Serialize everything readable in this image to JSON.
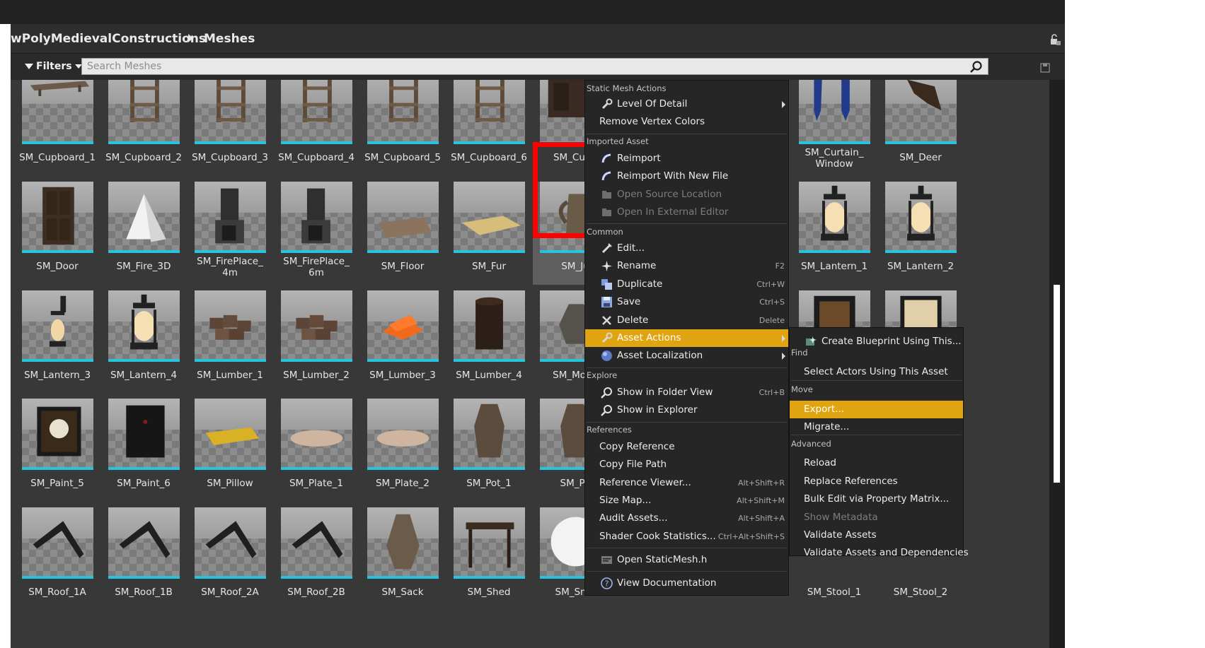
{
  "breadcrumb": {
    "root": "wPolyMedievalConstructions",
    "current": "Meshes"
  },
  "filters_label": "Filters",
  "search": {
    "placeholder": "Search Meshes",
    "value": ""
  },
  "assets": [
    {
      "name": "SM_Cupboard_1",
      "icon": "bench-mesh"
    },
    {
      "name": "SM_Cupboard_2",
      "icon": "shelf-mesh"
    },
    {
      "name": "SM_Cupboard_3",
      "icon": "shelf-mesh"
    },
    {
      "name": "SM_Cupboard_4",
      "icon": "shelf-mesh"
    },
    {
      "name": "SM_Cupboard_5",
      "icon": "shelf-mesh"
    },
    {
      "name": "SM_Cupboard_6",
      "icon": "shelf-mesh"
    },
    {
      "name": "SM_Cupb",
      "icon": "cupboard-mesh"
    },
    {
      "name": "",
      "icon": "hidden"
    },
    {
      "name": "",
      "icon": "hidden"
    },
    {
      "name": "SM_Curtain_Window",
      "icon": "curtain-mesh"
    },
    {
      "name": "SM_Deer",
      "icon": "deer-mesh"
    },
    {
      "name": "SM_Door",
      "icon": "door-mesh"
    },
    {
      "name": "SM_Fire_3D",
      "icon": "fire-cone-mesh"
    },
    {
      "name": "SM_FirePlace_4m",
      "icon": "fireplace-mesh"
    },
    {
      "name": "SM_FirePlace_6m",
      "icon": "fireplace-mesh"
    },
    {
      "name": "SM_Floor",
      "icon": "floor-mesh"
    },
    {
      "name": "SM_Fur",
      "icon": "fur-mesh"
    },
    {
      "name": "SM_Ju",
      "icon": "jug-mesh"
    },
    {
      "name": "",
      "icon": "hidden"
    },
    {
      "name": "",
      "icon": "hidden"
    },
    {
      "name": "SM_Lantern_1",
      "icon": "lantern-mesh"
    },
    {
      "name": "SM_Lantern_2",
      "icon": "lantern-mesh"
    },
    {
      "name": "SM_Lantern_3",
      "icon": "wall-lantern-mesh"
    },
    {
      "name": "SM_Lantern_4",
      "icon": "lantern-mesh"
    },
    {
      "name": "SM_Lumber_1",
      "icon": "lumber-mesh"
    },
    {
      "name": "SM_Lumber_2",
      "icon": "lumber-mesh"
    },
    {
      "name": "SM_Lumber_3",
      "icon": "lumber-orange-mesh"
    },
    {
      "name": "SM_Lumber_4",
      "icon": "stump-mesh"
    },
    {
      "name": "SM_Mone",
      "icon": "money-bag-mesh"
    },
    {
      "name": "",
      "icon": "hidden"
    },
    {
      "name": "",
      "icon": "hidden"
    },
    {
      "name": "",
      "icon": "book-frame-mesh"
    },
    {
      "name": "",
      "icon": "map-frame-mesh"
    },
    {
      "name": "SM_Paint_5",
      "icon": "eagle-painting-mesh"
    },
    {
      "name": "SM_Paint_6",
      "icon": "dark-painting-mesh"
    },
    {
      "name": "SM_Pillow",
      "icon": "pillow-mesh"
    },
    {
      "name": "SM_Plate_1",
      "icon": "plate-mesh"
    },
    {
      "name": "SM_Plate_2",
      "icon": "plate-mesh"
    },
    {
      "name": "SM_Pot_1",
      "icon": "pot-mesh"
    },
    {
      "name": "SM_Po",
      "icon": "pot-mesh"
    },
    {
      "name": "",
      "icon": "hidden"
    },
    {
      "name": "",
      "icon": "hidden"
    },
    {
      "name": "",
      "icon": "hidden"
    },
    {
      "name": "",
      "icon": "hidden"
    },
    {
      "name": "SM_Roof_1A",
      "icon": "roof-mesh"
    },
    {
      "name": "SM_Roof_1B",
      "icon": "roof-mesh"
    },
    {
      "name": "SM_Roof_2A",
      "icon": "roof-mesh"
    },
    {
      "name": "SM_Roof_2B",
      "icon": "roof-mesh"
    },
    {
      "name": "SM_Sack",
      "icon": "sack-mesh"
    },
    {
      "name": "SM_Shed",
      "icon": "table-mesh"
    },
    {
      "name": "SM_Smo",
      "icon": "sphere-mesh"
    },
    {
      "name": "",
      "icon": "hidden"
    },
    {
      "name": "",
      "icon": "hidden"
    },
    {
      "name": "SM_Stool_1",
      "icon": "hidden"
    },
    {
      "name": "SM_Stool_2",
      "icon": "hidden"
    }
  ],
  "context_menu": {
    "sections": [
      {
        "title": "Static Mesh Actions",
        "items": [
          {
            "label": "Level Of Detail",
            "icon": "wrench-icon",
            "submenu": true
          },
          {
            "label": "Remove Vertex Colors",
            "icon": ""
          }
        ]
      },
      {
        "title": "Imported Asset",
        "items": [
          {
            "label": "Reimport",
            "icon": "reimport-icon"
          },
          {
            "label": "Reimport With New File",
            "icon": "reimport-icon"
          },
          {
            "label": "Open Source Location",
            "icon": "folder-open-icon",
            "disabled": true
          },
          {
            "label": "Open In External Editor",
            "icon": "folder-open-icon",
            "disabled": true
          }
        ]
      },
      {
        "title": "Common",
        "items": [
          {
            "label": "Edit...",
            "icon": "edit-icon"
          },
          {
            "label": "Rename",
            "icon": "rename-icon",
            "shortcut": "F2"
          },
          {
            "label": "Duplicate",
            "icon": "duplicate-icon",
            "shortcut": "Ctrl+W"
          },
          {
            "label": "Save",
            "icon": "save-icon",
            "shortcut": "Ctrl+S"
          },
          {
            "label": "Delete",
            "icon": "delete-icon",
            "shortcut": "Delete"
          },
          {
            "label": "Asset Actions",
            "icon": "wrench-icon",
            "submenu": true,
            "highlighted": true
          },
          {
            "label": "Asset Localization",
            "icon": "globe-icon",
            "submenu": true
          }
        ]
      },
      {
        "title": "Explore",
        "items": [
          {
            "label": "Show in Folder View",
            "icon": "magnifier-icon",
            "shortcut": "Ctrl+B"
          },
          {
            "label": "Show in Explorer",
            "icon": "magnifier-icon"
          }
        ]
      },
      {
        "title": "References",
        "items": [
          {
            "label": "Copy Reference",
            "icon": ""
          },
          {
            "label": "Copy File Path",
            "icon": ""
          },
          {
            "label": "Reference Viewer...",
            "icon": "",
            "shortcut": "Alt+Shift+R"
          },
          {
            "label": "Size Map...",
            "icon": "",
            "shortcut": "Alt+Shift+M"
          },
          {
            "label": "Audit Assets...",
            "icon": "",
            "shortcut": "Alt+Shift+A"
          },
          {
            "label": "Shader Cook Statistics...",
            "icon": "",
            "shortcut": "Ctrl+Alt+Shift+S"
          }
        ]
      },
      {
        "title": "",
        "items": [
          {
            "label": "Open StaticMesh.h",
            "icon": "code-icon"
          }
        ]
      },
      {
        "title": "",
        "items": [
          {
            "label": "View Documentation",
            "icon": "help-icon"
          }
        ]
      }
    ]
  },
  "asset_actions_submenu": {
    "sections": [
      {
        "title": "",
        "items": [
          {
            "label": "Create Blueprint Using This...",
            "icon": "blueprint-icon"
          }
        ]
      },
      {
        "title": "Find",
        "items": [
          {
            "label": "Select Actors Using This Asset"
          }
        ]
      },
      {
        "title": "Move",
        "items": [
          {
            "label": "Export...",
            "highlighted": true
          },
          {
            "label": "Migrate..."
          }
        ]
      },
      {
        "title": "Advanced",
        "items": [
          {
            "label": "Reload"
          },
          {
            "label": "Replace References"
          },
          {
            "label": "Bulk Edit via Property Matrix..."
          },
          {
            "label": "Show Metadata",
            "disabled": true
          },
          {
            "label": "Validate Assets"
          },
          {
            "label": "Validate Assets and Dependencies"
          }
        ]
      }
    ]
  },
  "colors": {
    "highlight": "#e0a410",
    "thumb_underline": "#28c4dd",
    "annotation_box": "#ff0000"
  }
}
